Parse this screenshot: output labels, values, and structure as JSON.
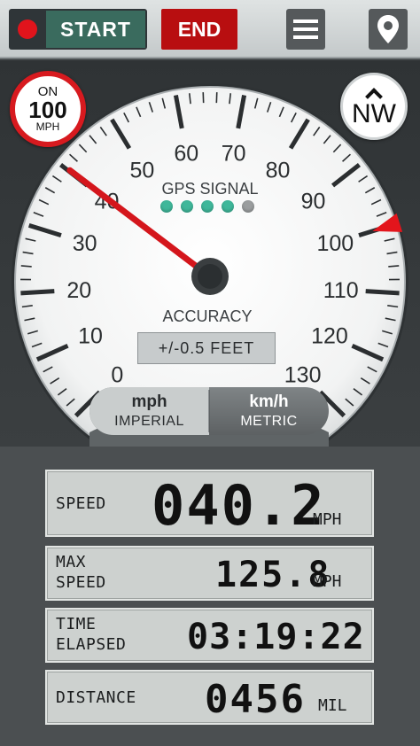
{
  "topbar": {
    "start_label": "START",
    "end_label": "END",
    "icons": {
      "record": "record-dot-icon",
      "menu": "hamburger-menu-icon",
      "location": "map-pin-icon"
    }
  },
  "speedometer": {
    "scale_labels": [
      "0",
      "10",
      "20",
      "30",
      "40",
      "50",
      "60",
      "70",
      "80",
      "90",
      "100",
      "110",
      "120",
      "130"
    ],
    "needle_speed": 40.2,
    "alert_marker_speed": 100,
    "gps_signal_label": "GPS SIGNAL",
    "gps_signal_bars": 4,
    "gps_signal_max": 5,
    "accuracy_label": "ACCURACY",
    "accuracy_value": "+/-0.5 FEET",
    "alert_badge": {
      "line1": "ON",
      "line2": "100",
      "line3": "MPH"
    },
    "compass": {
      "direction": "NW"
    },
    "units": {
      "imperial": {
        "main": "mph",
        "sub": "IMPERIAL"
      },
      "metric": {
        "main": "km/h",
        "sub": "METRIC"
      }
    },
    "colors": {
      "needle": "#d4161c",
      "gps_active": "#3fb79a",
      "alert": "#d71a1f"
    }
  },
  "readouts": {
    "speed": {
      "label": "SPEED",
      "value": "040.2",
      "unit": "MPH"
    },
    "max_speed": {
      "label_line1": "MAX",
      "label_line2": "SPEED",
      "value": "125.8",
      "unit": "MPH"
    },
    "time_elapsed": {
      "label_line1": "TIME",
      "label_line2": "ELAPSED",
      "value": "03:19:22"
    },
    "distance": {
      "label": "DISTANCE",
      "value": "0456",
      "unit": "MIL"
    }
  }
}
